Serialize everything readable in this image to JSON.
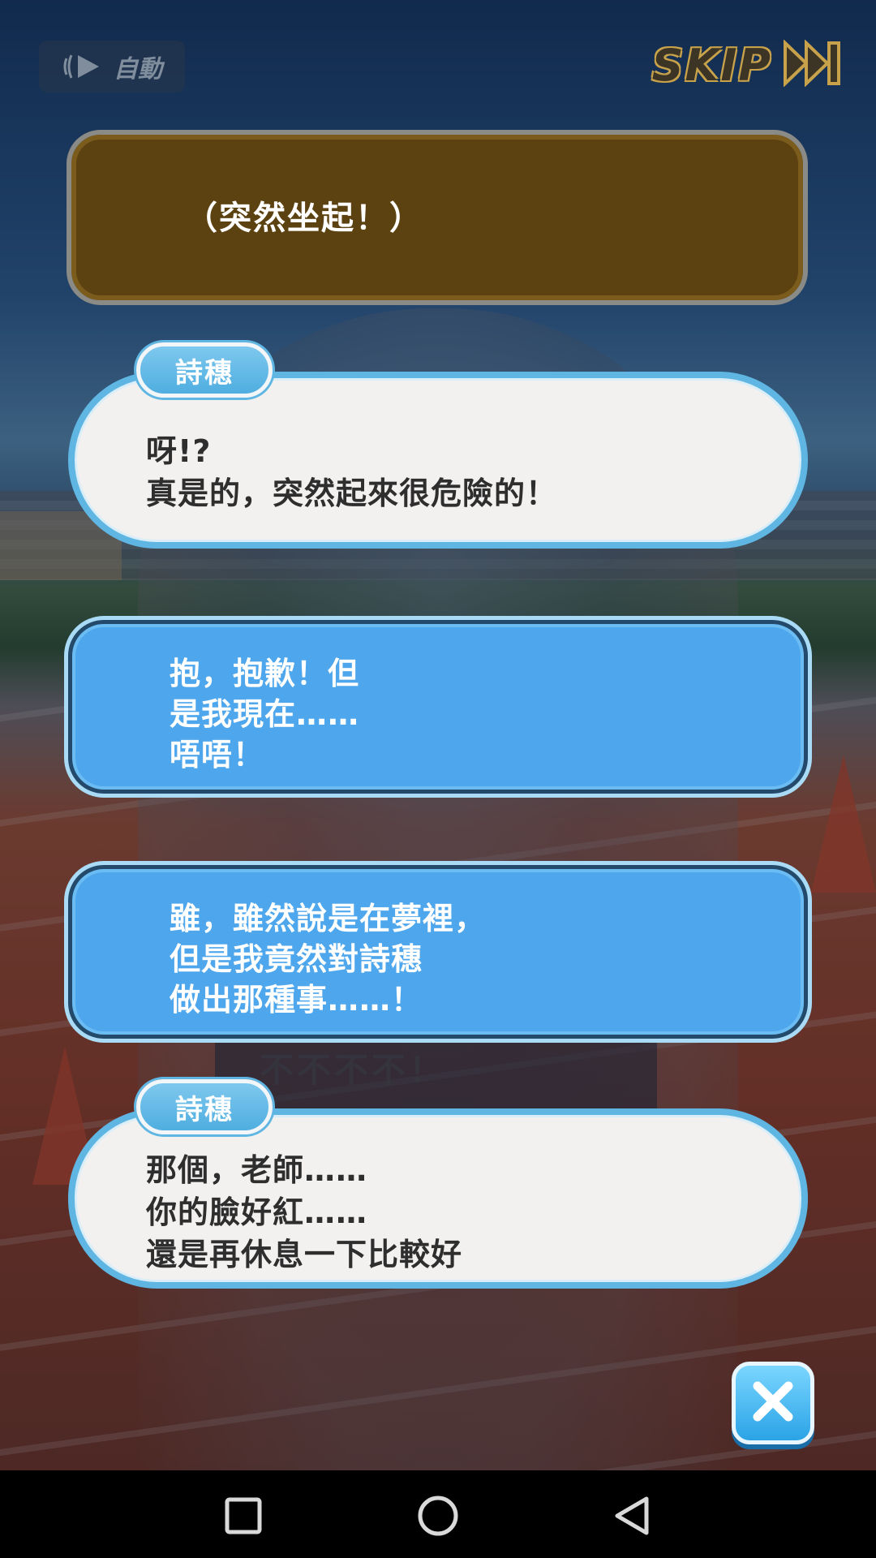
{
  "controls": {
    "auto_label": "自動",
    "skip_label": "SKIP"
  },
  "narration": {
    "text": "（突然坐起！）"
  },
  "dialogue": [
    {
      "speaker": "詩穗",
      "lines": [
        "呀!?",
        "真是的，突然起來很危險的！"
      ]
    },
    {
      "speaker": "詩穗",
      "lines": [
        "那個，老師……",
        "你的臉好紅……",
        "還是再休息一下比較好"
      ]
    }
  ],
  "choices": [
    {
      "lines": [
        "抱，抱歉！但",
        "是我現在……",
        "唔唔！"
      ]
    },
    {
      "lines": [
        "雖，雖然說是在夢裡，",
        "但是我竟然對詩穗",
        "做出那種事……！"
      ]
    }
  ],
  "background": {
    "sign_text": "不不不不！"
  },
  "colors": {
    "choice_blue": "#4ea6ec",
    "name_tag_blue": "#5fb6e2",
    "narration_brown": "#5c4211",
    "skip_gold": "#c8a24a"
  },
  "icons": {
    "auto": "play-with-sound-icon",
    "skip": "fast-forward-icon",
    "close": "close-x-icon",
    "nav": [
      "square-recents-icon",
      "circle-home-icon",
      "triangle-back-icon"
    ]
  }
}
